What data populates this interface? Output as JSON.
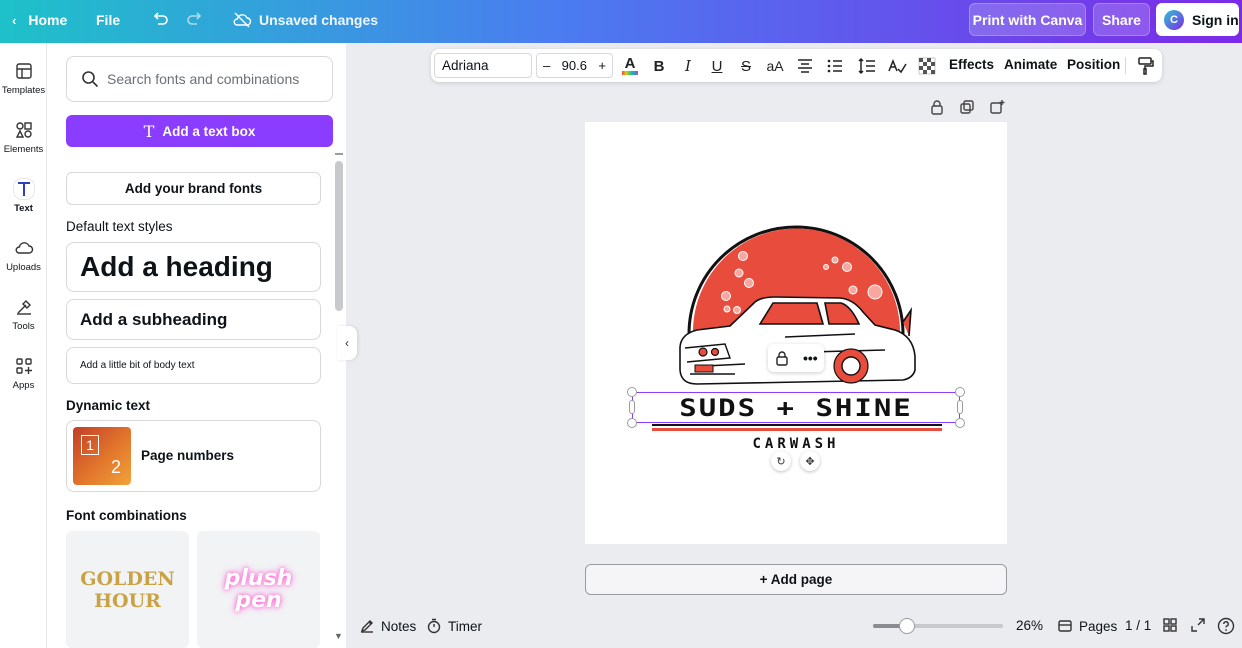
{
  "topbar": {
    "home": "Home",
    "file": "File",
    "unsaved": "Unsaved changes",
    "print": "Print with Canva",
    "share": "Share",
    "signin": "Sign in"
  },
  "rail": [
    {
      "label": "Templates",
      "icon": "templates-icon"
    },
    {
      "label": "Elements",
      "icon": "elements-icon"
    },
    {
      "label": "Text",
      "icon": "text-icon"
    },
    {
      "label": "Uploads",
      "icon": "uploads-icon"
    },
    {
      "label": "Tools",
      "icon": "tools-icon"
    },
    {
      "label": "Apps",
      "icon": "apps-icon"
    }
  ],
  "panel": {
    "search_placeholder": "Search fonts and combinations",
    "add_text_box": "Add a text box",
    "brand_fonts": "Add your brand fonts",
    "default_styles": "Default text styles",
    "heading": "Add a heading",
    "subheading": "Add a subheading",
    "body": "Add a little bit of body text",
    "dynamic": "Dynamic text",
    "page_numbers": "Page numbers",
    "font_combinations": "Font combinations",
    "combo1_line1": "GOLDEN",
    "combo1_line2": "HOUR",
    "combo2_line1": "plush",
    "combo2_line2": "pen"
  },
  "toolbar": {
    "font": "Adriana",
    "minus": "–",
    "size": "90.6",
    "plus": "+",
    "effects": "Effects",
    "animate": "Animate",
    "position": "Position"
  },
  "canvas": {
    "title": "SUDS + SHINE",
    "subtitle": "CARWASH",
    "add_page": "+ Add page"
  },
  "bottombar": {
    "notes": "Notes",
    "timer": "Timer",
    "zoom": "26%",
    "zoom_level": 0.26,
    "pages": "Pages",
    "page_count": "1 / 1"
  },
  "colors": {
    "accent": "#8b3dff",
    "logo_red": "#e74c3c",
    "gradient_start": "#1ec1c9",
    "gradient_end": "#7c2ae8"
  }
}
